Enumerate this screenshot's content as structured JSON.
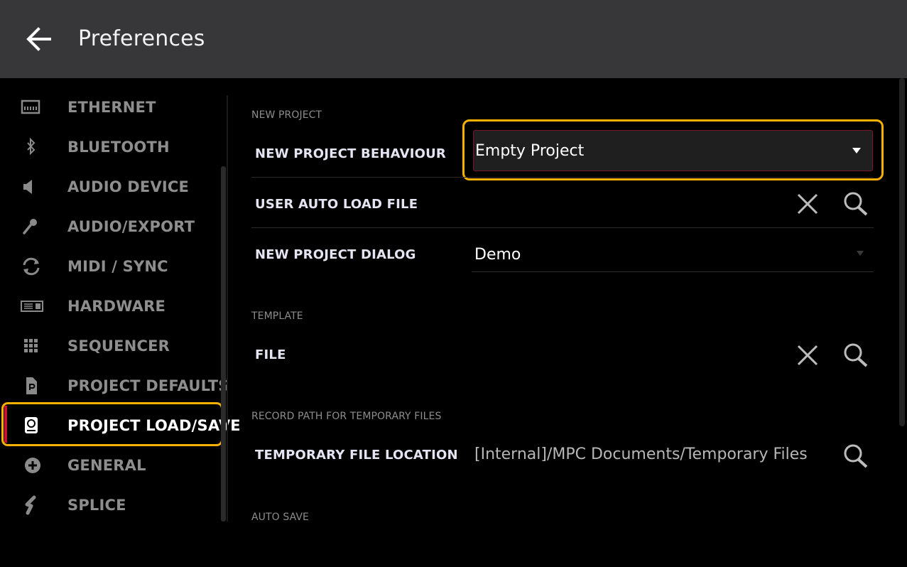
{
  "header": {
    "title": "Preferences",
    "back_icon": "arrow-left-icon"
  },
  "sidebar": {
    "items": [
      {
        "label": "ETHERNET",
        "icon": "ethernet-icon"
      },
      {
        "label": "BLUETOOTH",
        "icon": "bluetooth-icon"
      },
      {
        "label": "AUDIO DEVICE",
        "icon": "speaker-icon"
      },
      {
        "label": "AUDIO/EXPORT",
        "icon": "microphone-icon"
      },
      {
        "label": "MIDI / SYNC",
        "icon": "sync-icon"
      },
      {
        "label": "HARDWARE",
        "icon": "hardware-icon"
      },
      {
        "label": "SEQUENCER",
        "icon": "grid-icon"
      },
      {
        "label": "PROJECT DEFAULTS",
        "icon": "document-icon"
      },
      {
        "label": "PROJECT LOAD/SAVE",
        "icon": "drive-icon",
        "active": true
      },
      {
        "label": "GENERAL",
        "icon": "plus-circle-icon"
      },
      {
        "label": "SPLICE",
        "icon": "splice-icon"
      }
    ]
  },
  "sections": {
    "new_project": {
      "title": "NEW PROJECT",
      "behaviour_label": "NEW PROJECT BEHAVIOUR",
      "behaviour_value": "Empty Project",
      "auto_load_label": "USER AUTO LOAD FILE",
      "dialog_label": "NEW PROJECT DIALOG",
      "dialog_value": "Demo"
    },
    "template": {
      "title": "TEMPLATE",
      "file_label": "FILE"
    },
    "record_path": {
      "title": "RECORD PATH FOR TEMPORARY FILES",
      "location_label": "TEMPORARY FILE LOCATION",
      "location_value": "[Internal]/MPC Documents/Temporary Files"
    },
    "auto_save": {
      "title": "AUTO SAVE"
    }
  },
  "colors": {
    "header_bg": "#37373a",
    "highlight": "#f5b000",
    "active_accent": "#c41230",
    "background": "#000000"
  }
}
